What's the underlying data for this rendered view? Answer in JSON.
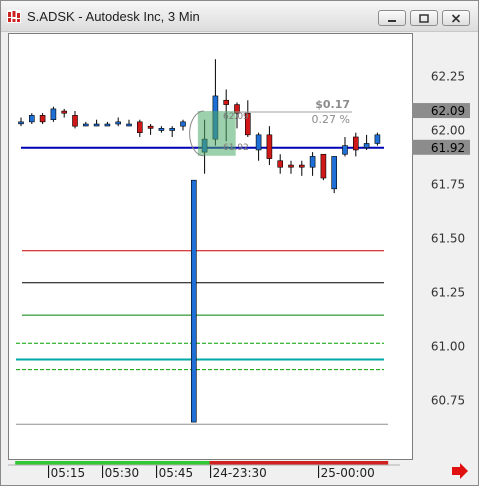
{
  "window": {
    "title": "S.ADSK - Autodesk Inc, 3 Min",
    "icon": "chart-app-icon",
    "controls": [
      "minimize-icon",
      "restore-icon",
      "close-icon"
    ]
  },
  "chart_data": {
    "type": "candlestick",
    "y_ticks": [
      "62.25",
      "62.00",
      "61.75",
      "61.50",
      "61.25",
      "61.00",
      "60.75"
    ],
    "ylim": [
      60.64,
      62.6
    ],
    "x_ticks": [
      {
        "label": "05:15",
        "i": 2
      },
      {
        "label": "05:30",
        "i": 7
      },
      {
        "label": "05:45",
        "i": 12
      },
      {
        "label": "24-23:30",
        "i": 17
      },
      {
        "label": "25-00:00",
        "i": 27
      }
    ],
    "candles": [
      {
        "o": 62.04,
        "h": 62.06,
        "l": 62.02,
        "c": 62.04
      },
      {
        "o": 62.04,
        "h": 62.08,
        "l": 62.03,
        "c": 62.07
      },
      {
        "o": 62.07,
        "h": 62.08,
        "l": 62.03,
        "c": 62.04
      },
      {
        "o": 62.05,
        "h": 62.11,
        "l": 62.04,
        "c": 62.1
      },
      {
        "o": 62.09,
        "h": 62.1,
        "l": 62.06,
        "c": 62.08
      },
      {
        "o": 62.07,
        "h": 62.09,
        "l": 62.01,
        "c": 62.02
      },
      {
        "o": 62.03,
        "h": 62.04,
        "l": 62.02,
        "c": 62.03
      },
      {
        "o": 62.03,
        "h": 62.05,
        "l": 62.02,
        "c": 62.03
      },
      {
        "o": 62.03,
        "h": 62.04,
        "l": 62.02,
        "c": 62.03
      },
      {
        "o": 62.03,
        "h": 62.06,
        "l": 62.02,
        "c": 62.04
      },
      {
        "o": 62.03,
        "h": 62.05,
        "l": 62.02,
        "c": 62.03
      },
      {
        "o": 62.04,
        "h": 62.05,
        "l": 61.97,
        "c": 61.99
      },
      {
        "o": 62.02,
        "h": 62.03,
        "l": 61.98,
        "c": 62.01
      },
      {
        "o": 62.0,
        "h": 62.02,
        "l": 61.99,
        "c": 62.01
      },
      {
        "o": 62.0,
        "h": 62.02,
        "l": 61.97,
        "c": 62.01
      },
      {
        "o": 62.02,
        "h": 62.05,
        "l": 62.0,
        "c": 62.04
      },
      {
        "o": 60.65,
        "h": 61.77,
        "l": 60.65,
        "c": 61.77
      },
      {
        "o": 61.9,
        "h": 62.05,
        "l": 61.8,
        "c": 61.96
      },
      {
        "o": 61.96,
        "h": 62.33,
        "l": 61.93,
        "c": 62.16
      },
      {
        "o": 62.14,
        "h": 62.19,
        "l": 61.95,
        "c": 62.12
      },
      {
        "o": 62.12,
        "h": 62.13,
        "l": 62.01,
        "c": 62.08
      },
      {
        "o": 62.08,
        "h": 62.14,
        "l": 61.97,
        "c": 61.98
      },
      {
        "o": 61.91,
        "h": 61.99,
        "l": 61.86,
        "c": 61.98
      },
      {
        "o": 61.98,
        "h": 62.02,
        "l": 61.84,
        "c": 61.87
      },
      {
        "o": 61.86,
        "h": 61.89,
        "l": 61.8,
        "c": 61.83
      },
      {
        "o": 61.84,
        "h": 61.86,
        "l": 61.8,
        "c": 61.83
      },
      {
        "o": 61.84,
        "h": 61.86,
        "l": 61.79,
        "c": 61.83
      },
      {
        "o": 61.83,
        "h": 61.9,
        "l": 61.79,
        "c": 61.88
      },
      {
        "o": 61.89,
        "h": 61.89,
        "l": 61.77,
        "c": 61.78
      },
      {
        "o": 61.73,
        "h": 61.88,
        "l": 61.71,
        "c": 61.88
      },
      {
        "o": 61.89,
        "h": 61.97,
        "l": 61.88,
        "c": 61.93
      },
      {
        "o": 61.97,
        "h": 61.99,
        "l": 61.88,
        "c": 61.91
      },
      {
        "o": 61.92,
        "h": 61.98,
        "l": 61.91,
        "c": 61.94
      },
      {
        "o": 61.94,
        "h": 61.99,
        "l": 61.93,
        "c": 61.98
      }
    ],
    "hlines": [
      {
        "y": 61.92,
        "color": "#0000b4",
        "style": "solid"
      },
      {
        "y": 61.443,
        "color": "#cc0000",
        "style": "solid"
      },
      {
        "y": 61.295,
        "color": "#000000",
        "style": "solid"
      },
      {
        "y": 61.145,
        "color": "#008000",
        "style": "solid"
      },
      {
        "y": 61.015,
        "color": "#00a000",
        "style": "dashed"
      },
      {
        "y": 60.94,
        "color": "#00a8a8",
        "style": "solid"
      },
      {
        "y": 60.893,
        "color": "#00a000",
        "style": "dashed"
      },
      {
        "y": 60.64,
        "color": "#909090",
        "style": "solid"
      }
    ],
    "price_tags": [
      {
        "label": "62.09",
        "y": 62.09,
        "bg": "#8c8c8c",
        "color": "#000000"
      },
      {
        "label": "61.92",
        "y": 61.92,
        "bg": "#8c8c8c",
        "color": "#000000"
      }
    ],
    "measure": {
      "amount": "$0.17",
      "percent": "0.27 %",
      "from_label": "61.92",
      "to_label": "62.09",
      "from_y": 61.92,
      "to_y": 62.09,
      "i_start": 17.3,
      "i_end": 19.6
    },
    "time_segments": [
      {
        "from": -0.5,
        "to": 17.5,
        "color": "#33c833"
      },
      {
        "from": 17.5,
        "to": 34,
        "color": "#d02020"
      }
    ],
    "colors": {
      "up": "#1e6fd6",
      "down": "#d01818"
    },
    "scroll_arrow": "red-right-arrow-icon"
  }
}
